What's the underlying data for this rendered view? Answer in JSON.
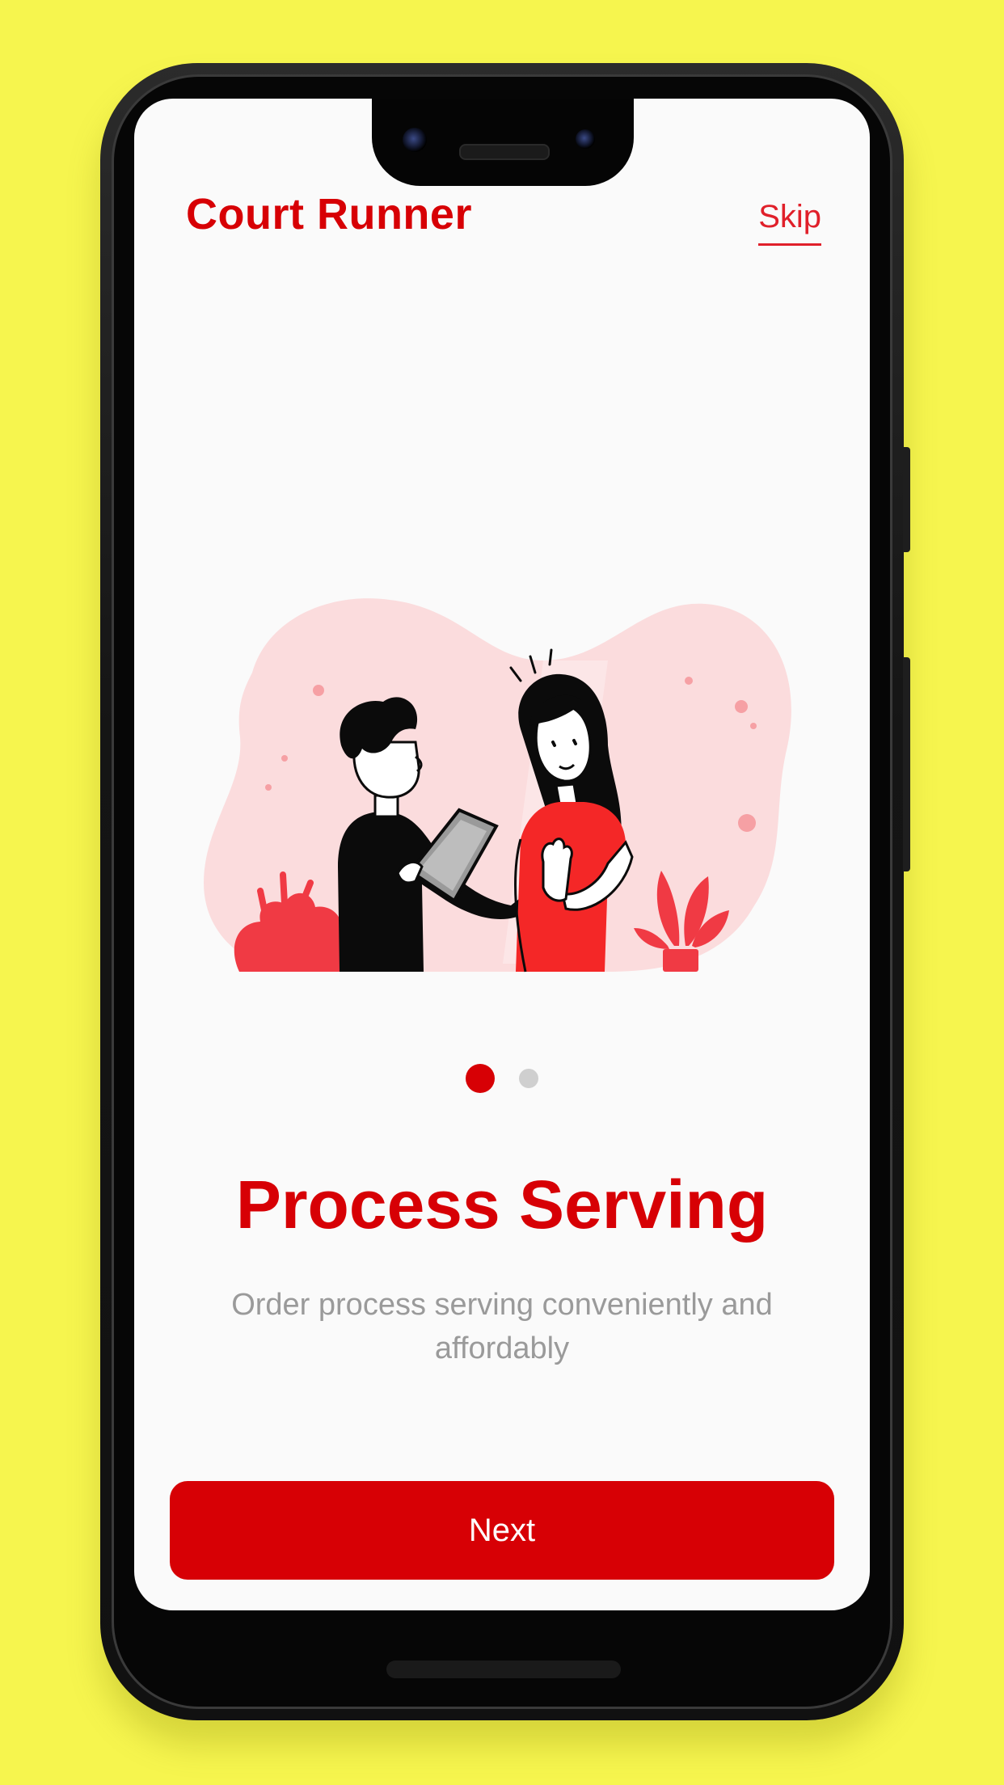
{
  "app": {
    "title": "Court Runner",
    "skip_label": "Skip"
  },
  "illustration": {
    "icon": "process-serving-illustration"
  },
  "pager": {
    "total": 2,
    "active_index": 0
  },
  "onboarding": {
    "heading": "Process Serving",
    "subtitle": "Order process serving conveniently and affordably"
  },
  "actions": {
    "next_label": "Next"
  },
  "colors": {
    "brand": "#d70005",
    "background": "#f6f54e",
    "screen": "#fafafa",
    "subtitle": "#9a9a9a",
    "blob": "#fbdcdd"
  }
}
